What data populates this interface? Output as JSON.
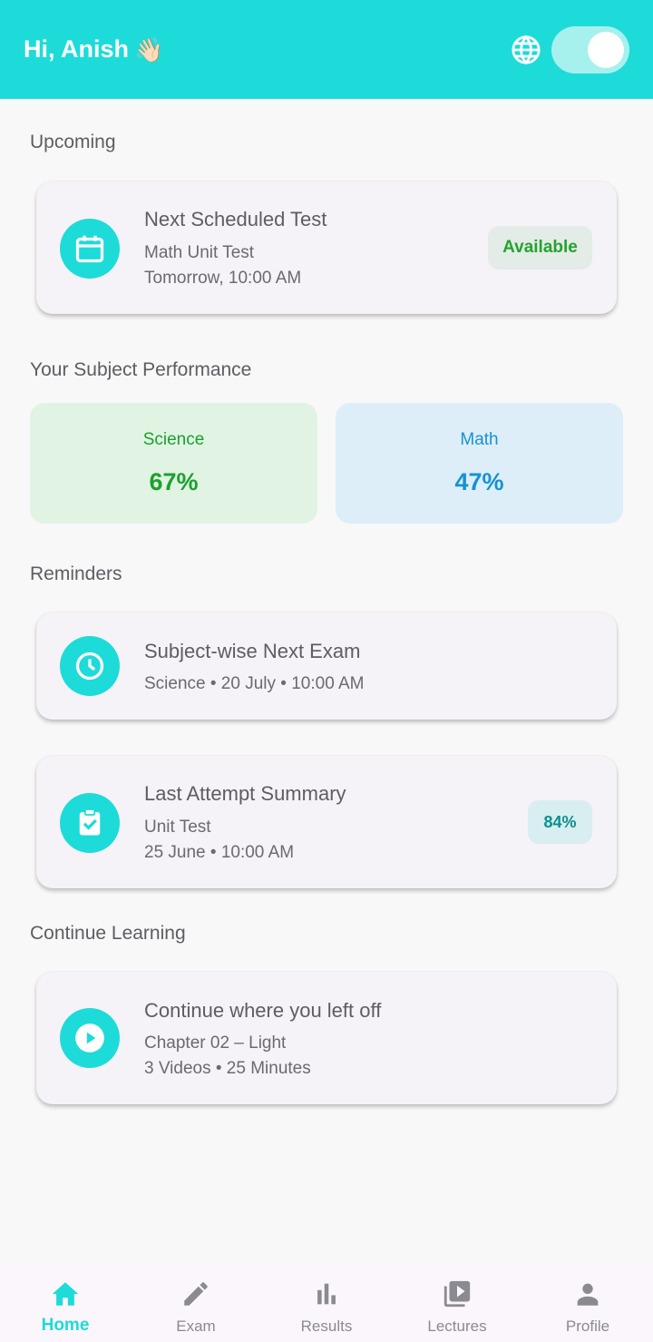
{
  "header": {
    "greeting": "Hi, Anish",
    "wave_emoji": "👋🏻",
    "language_icon": "globe-icon",
    "theme_toggle": "on"
  },
  "upcoming": {
    "section_title": "Upcoming",
    "card": {
      "icon": "calendar-icon",
      "title": "Next Scheduled Test",
      "subtitle": "Math Unit Test",
      "time": "Tomorrow, 10:00 AM",
      "status": "Available"
    }
  },
  "performance": {
    "section_title": "Your Subject Performance",
    "subjects": [
      {
        "name": "Science",
        "value": "67%",
        "color": "#1aa12f",
        "bg": "#e1f3e3"
      },
      {
        "name": "Math",
        "value": "47%",
        "color": "#1592d6",
        "bg": "#deeef9"
      }
    ]
  },
  "reminders": {
    "section_title": "Reminders",
    "next_exam": {
      "icon": "clock-icon",
      "title": "Subject-wise Next Exam",
      "detail": "Science • 20 July • 10:00 AM"
    },
    "last_attempt": {
      "icon": "clipboard-check-icon",
      "title": "Last Attempt Summary",
      "subtitle": "Unit Test",
      "detail": "25 June • 10:00 AM",
      "score": "84%"
    }
  },
  "continue_learning": {
    "section_title": "Continue Learning",
    "card": {
      "icon": "play-icon",
      "title": "Continue where you left off",
      "subtitle": "Chapter 02 – Light",
      "detail": "3 Videos • 25 Minutes"
    }
  },
  "bottom_nav": {
    "items": [
      {
        "label": "Home",
        "icon": "home-icon",
        "active": true
      },
      {
        "label": "Exam",
        "icon": "pencil-icon",
        "active": false
      },
      {
        "label": "Results",
        "icon": "bar-chart-icon",
        "active": false
      },
      {
        "label": "Lectures",
        "icon": "video-library-icon",
        "active": false
      },
      {
        "label": "Profile",
        "icon": "person-icon",
        "active": false
      }
    ]
  },
  "colors": {
    "accent": "#1ddbd9",
    "card_bg": "#f5f2f8",
    "available_pill_bg": "#e3ece6",
    "available_pill_text": "#24a32f",
    "score_pill_bg": "#d8eef0",
    "score_pill_text": "#0d8f8f"
  }
}
